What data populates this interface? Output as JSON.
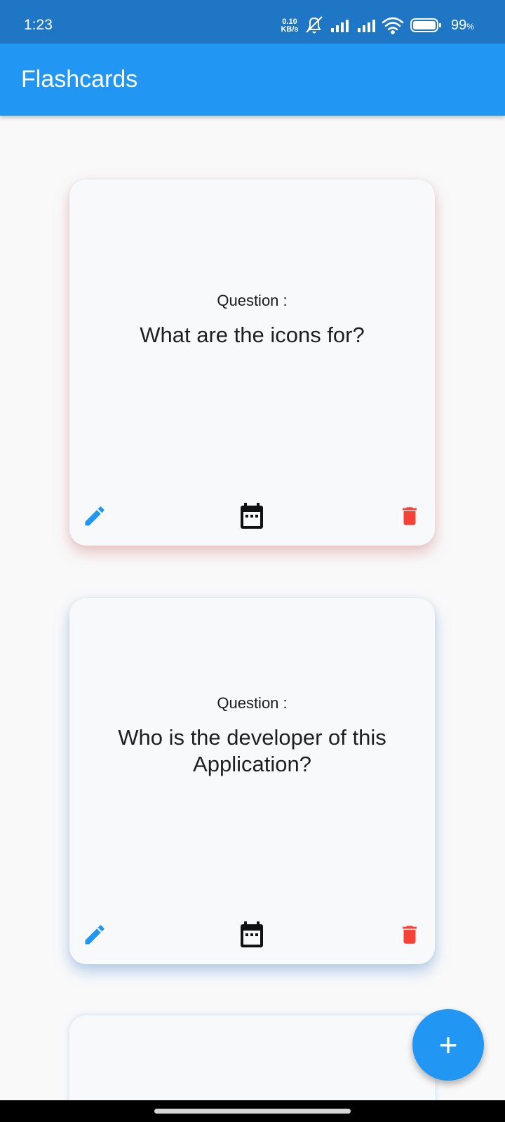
{
  "status_bar": {
    "time": "1:23",
    "net_speed_value": "0.10",
    "net_speed_unit": "KB/s",
    "battery_pct": "99",
    "battery_unit": "%",
    "icons": [
      "mute-alarm-icon",
      "signal-1-icon",
      "signal-2-icon",
      "wifi-icon",
      "battery-icon"
    ]
  },
  "app_bar": {
    "title": "Flashcards"
  },
  "cards": [
    {
      "label": "Question :",
      "question": "What are the icons for?",
      "icons": {
        "edit": "edit-icon",
        "schedule": "calendar-icon",
        "delete": "delete-icon"
      }
    },
    {
      "label": "Question :",
      "question": "Who is the developer of this Application?",
      "icons": {
        "edit": "edit-icon",
        "schedule": "calendar-icon",
        "delete": "delete-icon"
      }
    }
  ],
  "fab": {
    "label": "+",
    "icon": "add-icon"
  },
  "colors": {
    "status_bar": "#1f76c4",
    "app_bar": "#2196f3",
    "edit": "#2196f3",
    "delete": "#f44336",
    "calendar": "#111111"
  }
}
